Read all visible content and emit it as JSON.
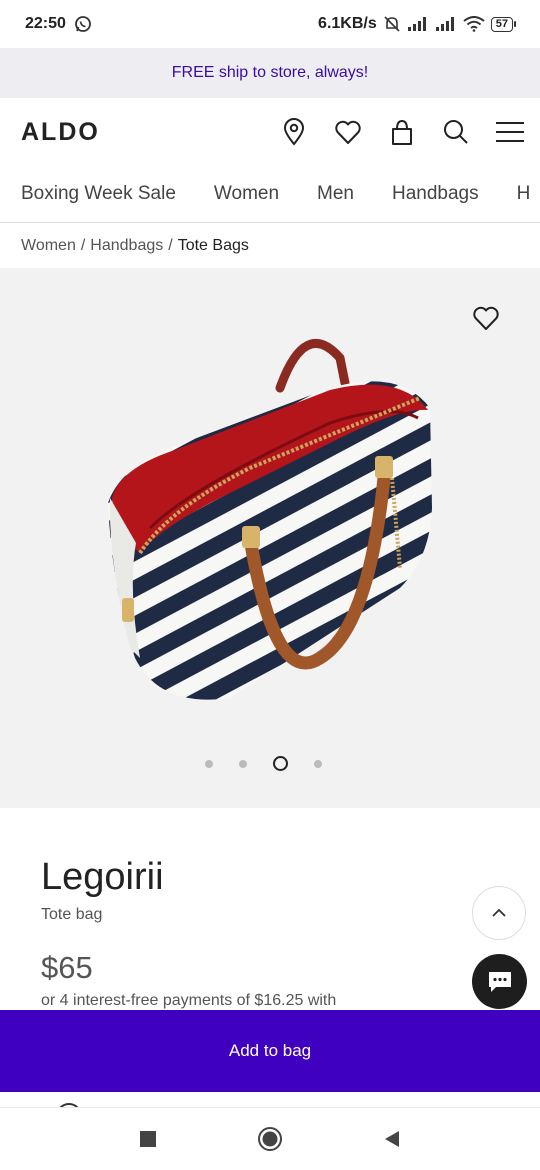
{
  "status_bar": {
    "time": "22:50",
    "network_speed": "6.1KB/s",
    "battery_level": "57",
    "icons": [
      "whatsapp-icon",
      "mute-alarm-icon",
      "signal-icon",
      "signal-roaming-icon",
      "wifi-icon",
      "battery-icon"
    ]
  },
  "promo": {
    "text": "FREE ship to store, always!"
  },
  "header": {
    "logo": "ALDO",
    "icons": [
      "location-pin-icon",
      "heart-icon",
      "shopping-bag-icon",
      "search-icon",
      "menu-icon"
    ]
  },
  "categories": [
    {
      "label": "Boxing Week Sale"
    },
    {
      "label": "Women"
    },
    {
      "label": "Men"
    },
    {
      "label": "Handbags"
    },
    {
      "label": "H"
    }
  ],
  "breadcrumb": {
    "items": [
      "Women",
      "Handbags"
    ],
    "separator": "/",
    "current": "Tote Bags"
  },
  "gallery": {
    "image": "striped-tote-bag-image",
    "slide_count": 4,
    "active_slide": 3
  },
  "product": {
    "name": "Legoirii",
    "type": "Tote bag",
    "price": "$65",
    "installments": "or 4 interest-free payments of $16.25 with"
  },
  "actions": {
    "add_to_bag": "Add to bag"
  },
  "colors": {
    "accent": "#3f00bf",
    "promo_text": "#3a0ca3",
    "promo_bg": "#eeeef2",
    "bag_lining": "#b3151b",
    "bag_stripe": "#1f2a44",
    "bag_handle": "#a0582a"
  }
}
